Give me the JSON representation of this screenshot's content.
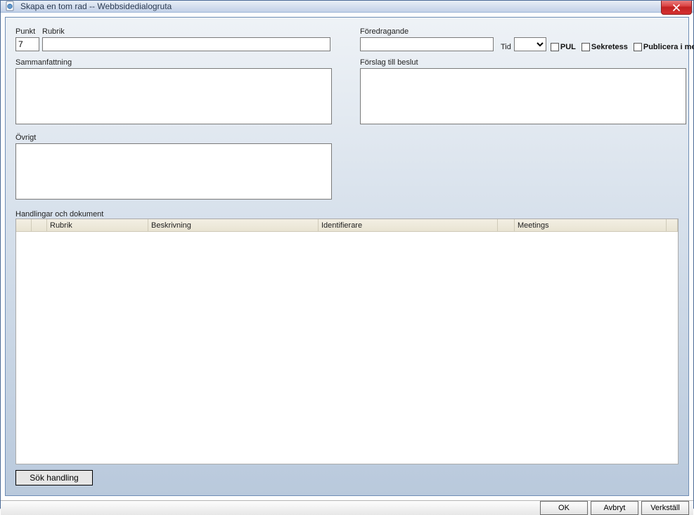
{
  "window": {
    "title": "Skapa en tom rad -- Webbsidedialogruta"
  },
  "form": {
    "punkt_label": "Punkt",
    "punkt_value": "7",
    "rubrik_label": "Rubrik",
    "rubrik_value": "",
    "foredragande_label": "Föredragande",
    "foredragande_value": "",
    "tid_label": "Tid",
    "tid_value": "",
    "check_pul": "PUL",
    "check_sekretess": "Sekretess",
    "check_publicera": "Publicera i meetings",
    "sammanfattning_label": "Sammanfattning",
    "sammanfattning_value": "",
    "forslag_label": "Förslag till beslut",
    "forslag_value": "",
    "ovrigt_label": "Övrigt",
    "ovrigt_value": ""
  },
  "documents": {
    "section_label": "Handlingar och dokument",
    "columns": {
      "rubrik": "Rubrik",
      "beskrivning": "Beskrivning",
      "identifierare": "Identifierare",
      "meetings": "Meetings"
    },
    "search_button": "Sök handling"
  },
  "footer": {
    "ok": "OK",
    "avbryt": "Avbryt",
    "verkstall": "Verkställ"
  }
}
